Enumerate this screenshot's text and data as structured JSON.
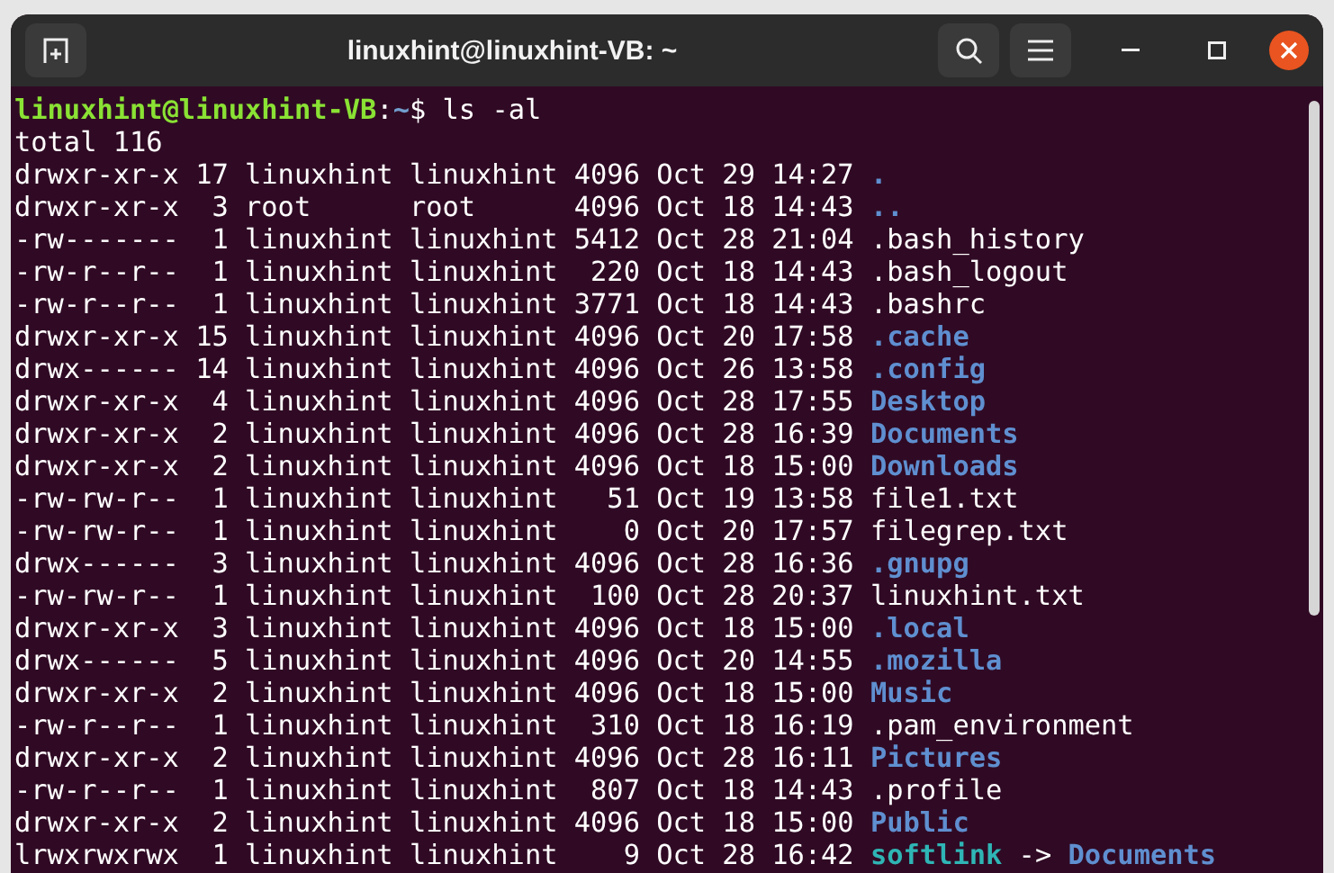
{
  "window": {
    "title": "linuxhint@linuxhint-VB: ~"
  },
  "prompt": {
    "user_host": "linuxhint@linuxhint-VB",
    "separator": ":",
    "path": "~",
    "command": "$ ls -al"
  },
  "output_header": "total 116",
  "entries": [
    {
      "info": "drwxr-xr-x 17 linuxhint linuxhint 4096 Oct 29 14:27",
      "name": ".",
      "kind": "dir"
    },
    {
      "info": "drwxr-xr-x  3 root      root      4096 Oct 18 14:43",
      "name": "..",
      "kind": "dir"
    },
    {
      "info": "-rw-------  1 linuxhint linuxhint 5412 Oct 28 21:04",
      "name": ".bash_history",
      "kind": "file"
    },
    {
      "info": "-rw-r--r--  1 linuxhint linuxhint  220 Oct 18 14:43",
      "name": ".bash_logout",
      "kind": "file"
    },
    {
      "info": "-rw-r--r--  1 linuxhint linuxhint 3771 Oct 18 14:43",
      "name": ".bashrc",
      "kind": "file"
    },
    {
      "info": "drwxr-xr-x 15 linuxhint linuxhint 4096 Oct 20 17:58",
      "name": ".cache",
      "kind": "dir"
    },
    {
      "info": "drwx------ 14 linuxhint linuxhint 4096 Oct 26 13:58",
      "name": ".config",
      "kind": "dir"
    },
    {
      "info": "drwxr-xr-x  4 linuxhint linuxhint 4096 Oct 28 17:55",
      "name": "Desktop",
      "kind": "dir"
    },
    {
      "info": "drwxr-xr-x  2 linuxhint linuxhint 4096 Oct 28 16:39",
      "name": "Documents",
      "kind": "dir"
    },
    {
      "info": "drwxr-xr-x  2 linuxhint linuxhint 4096 Oct 18 15:00",
      "name": "Downloads",
      "kind": "dir"
    },
    {
      "info": "-rw-rw-r--  1 linuxhint linuxhint   51 Oct 19 13:58",
      "name": "file1.txt",
      "kind": "file"
    },
    {
      "info": "-rw-rw-r--  1 linuxhint linuxhint    0 Oct 20 17:57",
      "name": "filegrep.txt",
      "kind": "file"
    },
    {
      "info": "drwx------  3 linuxhint linuxhint 4096 Oct 28 16:36",
      "name": ".gnupg",
      "kind": "dir"
    },
    {
      "info": "-rw-rw-r--  1 linuxhint linuxhint  100 Oct 28 20:37",
      "name": "linuxhint.txt",
      "kind": "file"
    },
    {
      "info": "drwxr-xr-x  3 linuxhint linuxhint 4096 Oct 18 15:00",
      "name": ".local",
      "kind": "dir"
    },
    {
      "info": "drwx------  5 linuxhint linuxhint 4096 Oct 20 14:55",
      "name": ".mozilla",
      "kind": "dir"
    },
    {
      "info": "drwxr-xr-x  2 linuxhint linuxhint 4096 Oct 18 15:00",
      "name": "Music",
      "kind": "dir"
    },
    {
      "info": "-rw-r--r--  1 linuxhint linuxhint  310 Oct 18 16:19",
      "name": ".pam_environment",
      "kind": "file"
    },
    {
      "info": "drwxr-xr-x  2 linuxhint linuxhint 4096 Oct 28 16:11",
      "name": "Pictures",
      "kind": "dir"
    },
    {
      "info": "-rw-r--r--  1 linuxhint linuxhint  807 Oct 18 14:43",
      "name": ".profile",
      "kind": "file"
    },
    {
      "info": "drwxr-xr-x  2 linuxhint linuxhint 4096 Oct 18 15:00",
      "name": "Public",
      "kind": "dir"
    },
    {
      "info": "lrwxrwxrwx  1 linuxhint linuxhint    9 Oct 28 16:42",
      "name": "softlink",
      "kind": "link",
      "arrow": "->",
      "target": "Documents"
    }
  ]
}
